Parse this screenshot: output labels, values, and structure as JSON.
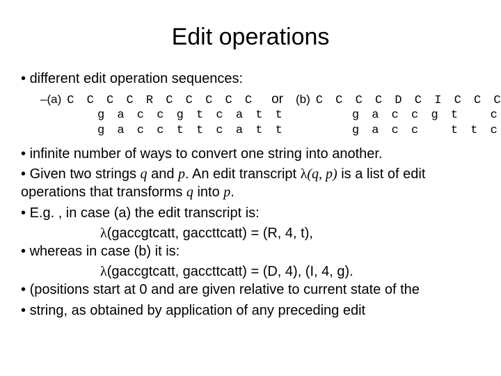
{
  "title": "Edit operations",
  "b_intro": "different edit operation sequences:",
  "seq": {
    "a_label": "(a)",
    "a1": "C C C C R C C C C C",
    "a2": "g a c c g t c a t t",
    "a3": "g a c c t t c a t t",
    "or": "or",
    "b_label": "(b)",
    "b1": "C C C C D C I C C C C",
    "b2": "g a c c g t   c a t t",
    "b3": "g a c c   t t c a t t"
  },
  "b_infinite": "infinite number of ways to convert one string into another.",
  "b_given_1": "Given two strings ",
  "b_given_q": "q",
  "b_given_2": " and ",
  "b_given_p": "p",
  "b_given_3": ". An edit transcript ",
  "b_given_lam": "λ",
  "b_given_paren": "(q, p)",
  "b_given_4": " is a list of edit operations that transforms ",
  "b_given_q2": "q",
  "b_given_5": " into ",
  "b_given_p2": "p",
  "b_given_6": ".",
  "b_eg_a": "E.g. , in case (a) the edit transcript is:",
  "eg_a_line": "λ(gaccgtcatt, gaccttcatt) = (R, 4, t),",
  "b_eg_b": "whereas in case (b) it is:",
  "eg_b_line": "λ(gaccgtcatt, gaccttcatt) = (D, 4), (I, 4, g).",
  "b_pos": "(positions start at 0 and are given relative to current state of the",
  "b_string": "string, as obtained by application of any preceding edit"
}
